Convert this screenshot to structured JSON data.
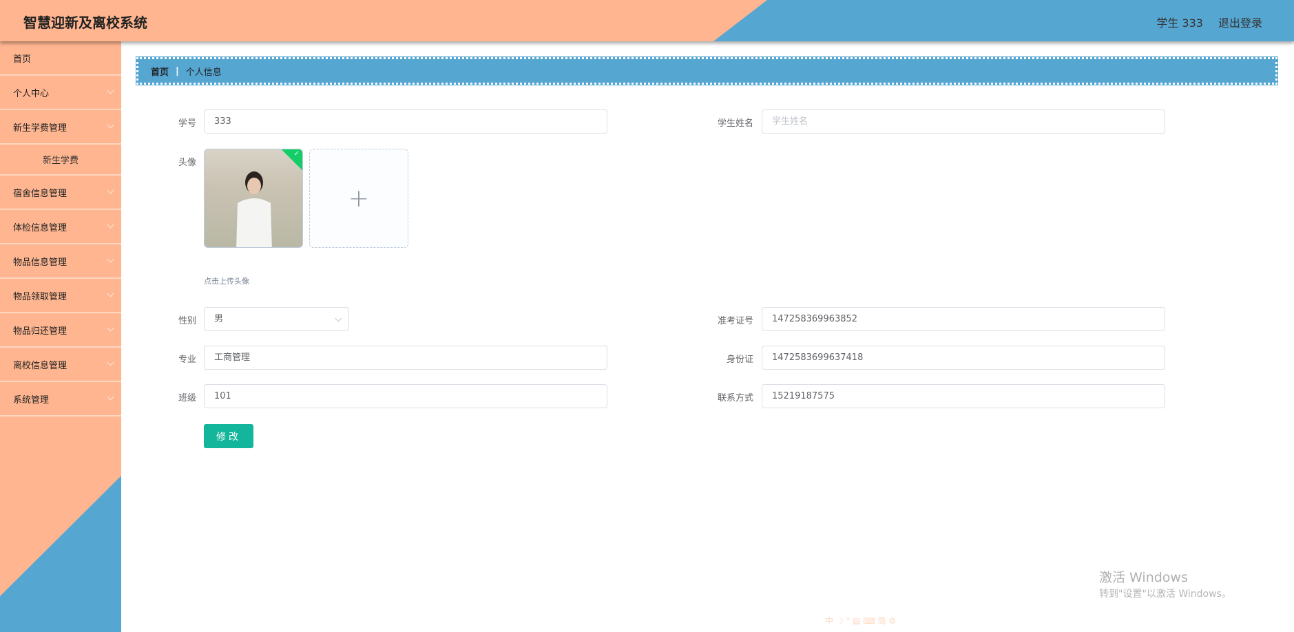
{
  "header": {
    "title": "智慧迎新及离校系统",
    "user": "学生 333",
    "logout": "退出登录"
  },
  "sidebar": {
    "items": [
      {
        "label": "首页",
        "has_children": false
      },
      {
        "label": "个人中心",
        "has_children": true
      },
      {
        "label": "新生学费管理",
        "has_children": true
      },
      {
        "label": "新生学费",
        "sub": true
      },
      {
        "label": "宿舍信息管理",
        "has_children": true
      },
      {
        "label": "体检信息管理",
        "has_children": true
      },
      {
        "label": "物品信息管理",
        "has_children": true
      },
      {
        "label": "物品领取管理",
        "has_children": true
      },
      {
        "label": "物品归还管理",
        "has_children": true
      },
      {
        "label": "离校信息管理",
        "has_children": true
      },
      {
        "label": "系统管理",
        "has_children": true
      }
    ]
  },
  "breadcrumb": {
    "home": "首页",
    "current": "个人信息"
  },
  "form": {
    "student_no": {
      "label": "学号",
      "value": "333"
    },
    "student_name": {
      "label": "学生姓名",
      "placeholder": "学生姓名",
      "value": ""
    },
    "avatar": {
      "label": "头像",
      "hint": "点击上传头像",
      "add": "+",
      "check": "✓"
    },
    "gender": {
      "label": "性别",
      "value": "男"
    },
    "exam_no": {
      "label": "准考证号",
      "value": "147258369963852"
    },
    "major": {
      "label": "专业",
      "value": "工商管理"
    },
    "id_card": {
      "label": "身份证",
      "value": "1472583699637418"
    },
    "class": {
      "label": "班级",
      "value": "101"
    },
    "phone": {
      "label": "联系方式",
      "value": "15219187575"
    },
    "submit": "修改"
  },
  "watermark": {
    "line1": "激活 Windows",
    "line2": "转到\"设置\"以激活 Windows。"
  },
  "ime_bar": "中 ☽ ° ▤ ⌨ 简 ⚙",
  "colors": {
    "peach": "#ffb690",
    "blue": "#56a6d2",
    "button": "#13b69a"
  }
}
